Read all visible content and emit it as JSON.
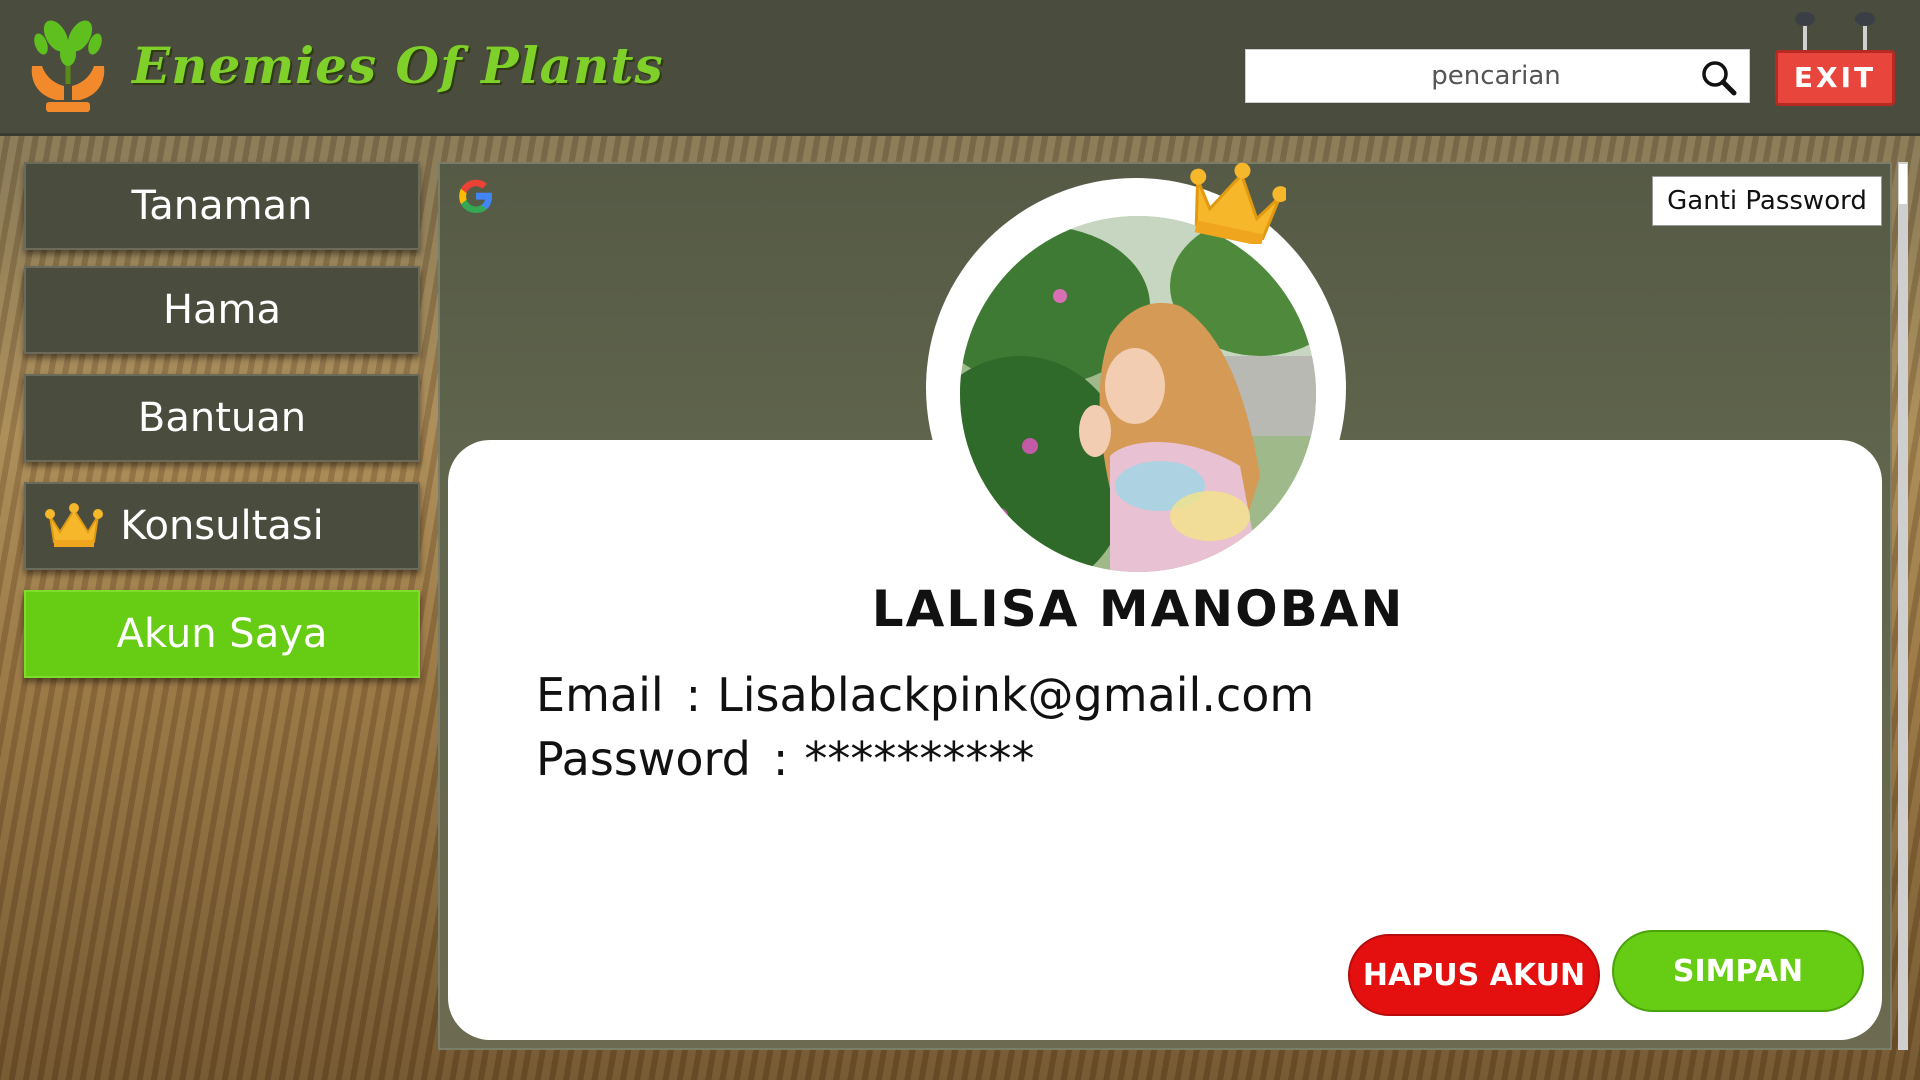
{
  "app": {
    "title": "Enemies Of Plants"
  },
  "search": {
    "placeholder": "pencarian",
    "value": ""
  },
  "header": {
    "exit_label": "EXIT"
  },
  "sidebar": {
    "items": [
      {
        "label": "Tanaman",
        "active": false,
        "icon": null
      },
      {
        "label": "Hama",
        "active": false,
        "icon": null
      },
      {
        "label": "Bantuan",
        "active": false,
        "icon": null
      },
      {
        "label": "Konsultasi",
        "active": false,
        "icon": "crown-icon"
      },
      {
        "label": "Akun Saya",
        "active": true,
        "icon": null
      }
    ]
  },
  "profile": {
    "change_password_label": "Ganti Password",
    "name": "LALISA MANOBAN",
    "email_label": "Email",
    "email_value": "Lisablackpink@gmail.com",
    "password_label": "Password",
    "password_value": "**********",
    "separator": ":",
    "delete_button": "HAPUS AKUN",
    "save_button": "SIMPAN"
  },
  "icons": {
    "logo": "plant-hands-logo-icon",
    "search": "search-icon",
    "google": "google-icon",
    "premium": "crown-icon"
  },
  "colors": {
    "header_bg": "#4a4c3d",
    "brand_green": "#66cc14",
    "title_green": "#7fd12a",
    "danger_red": "#e3100f",
    "exit_red": "#e8453c"
  }
}
